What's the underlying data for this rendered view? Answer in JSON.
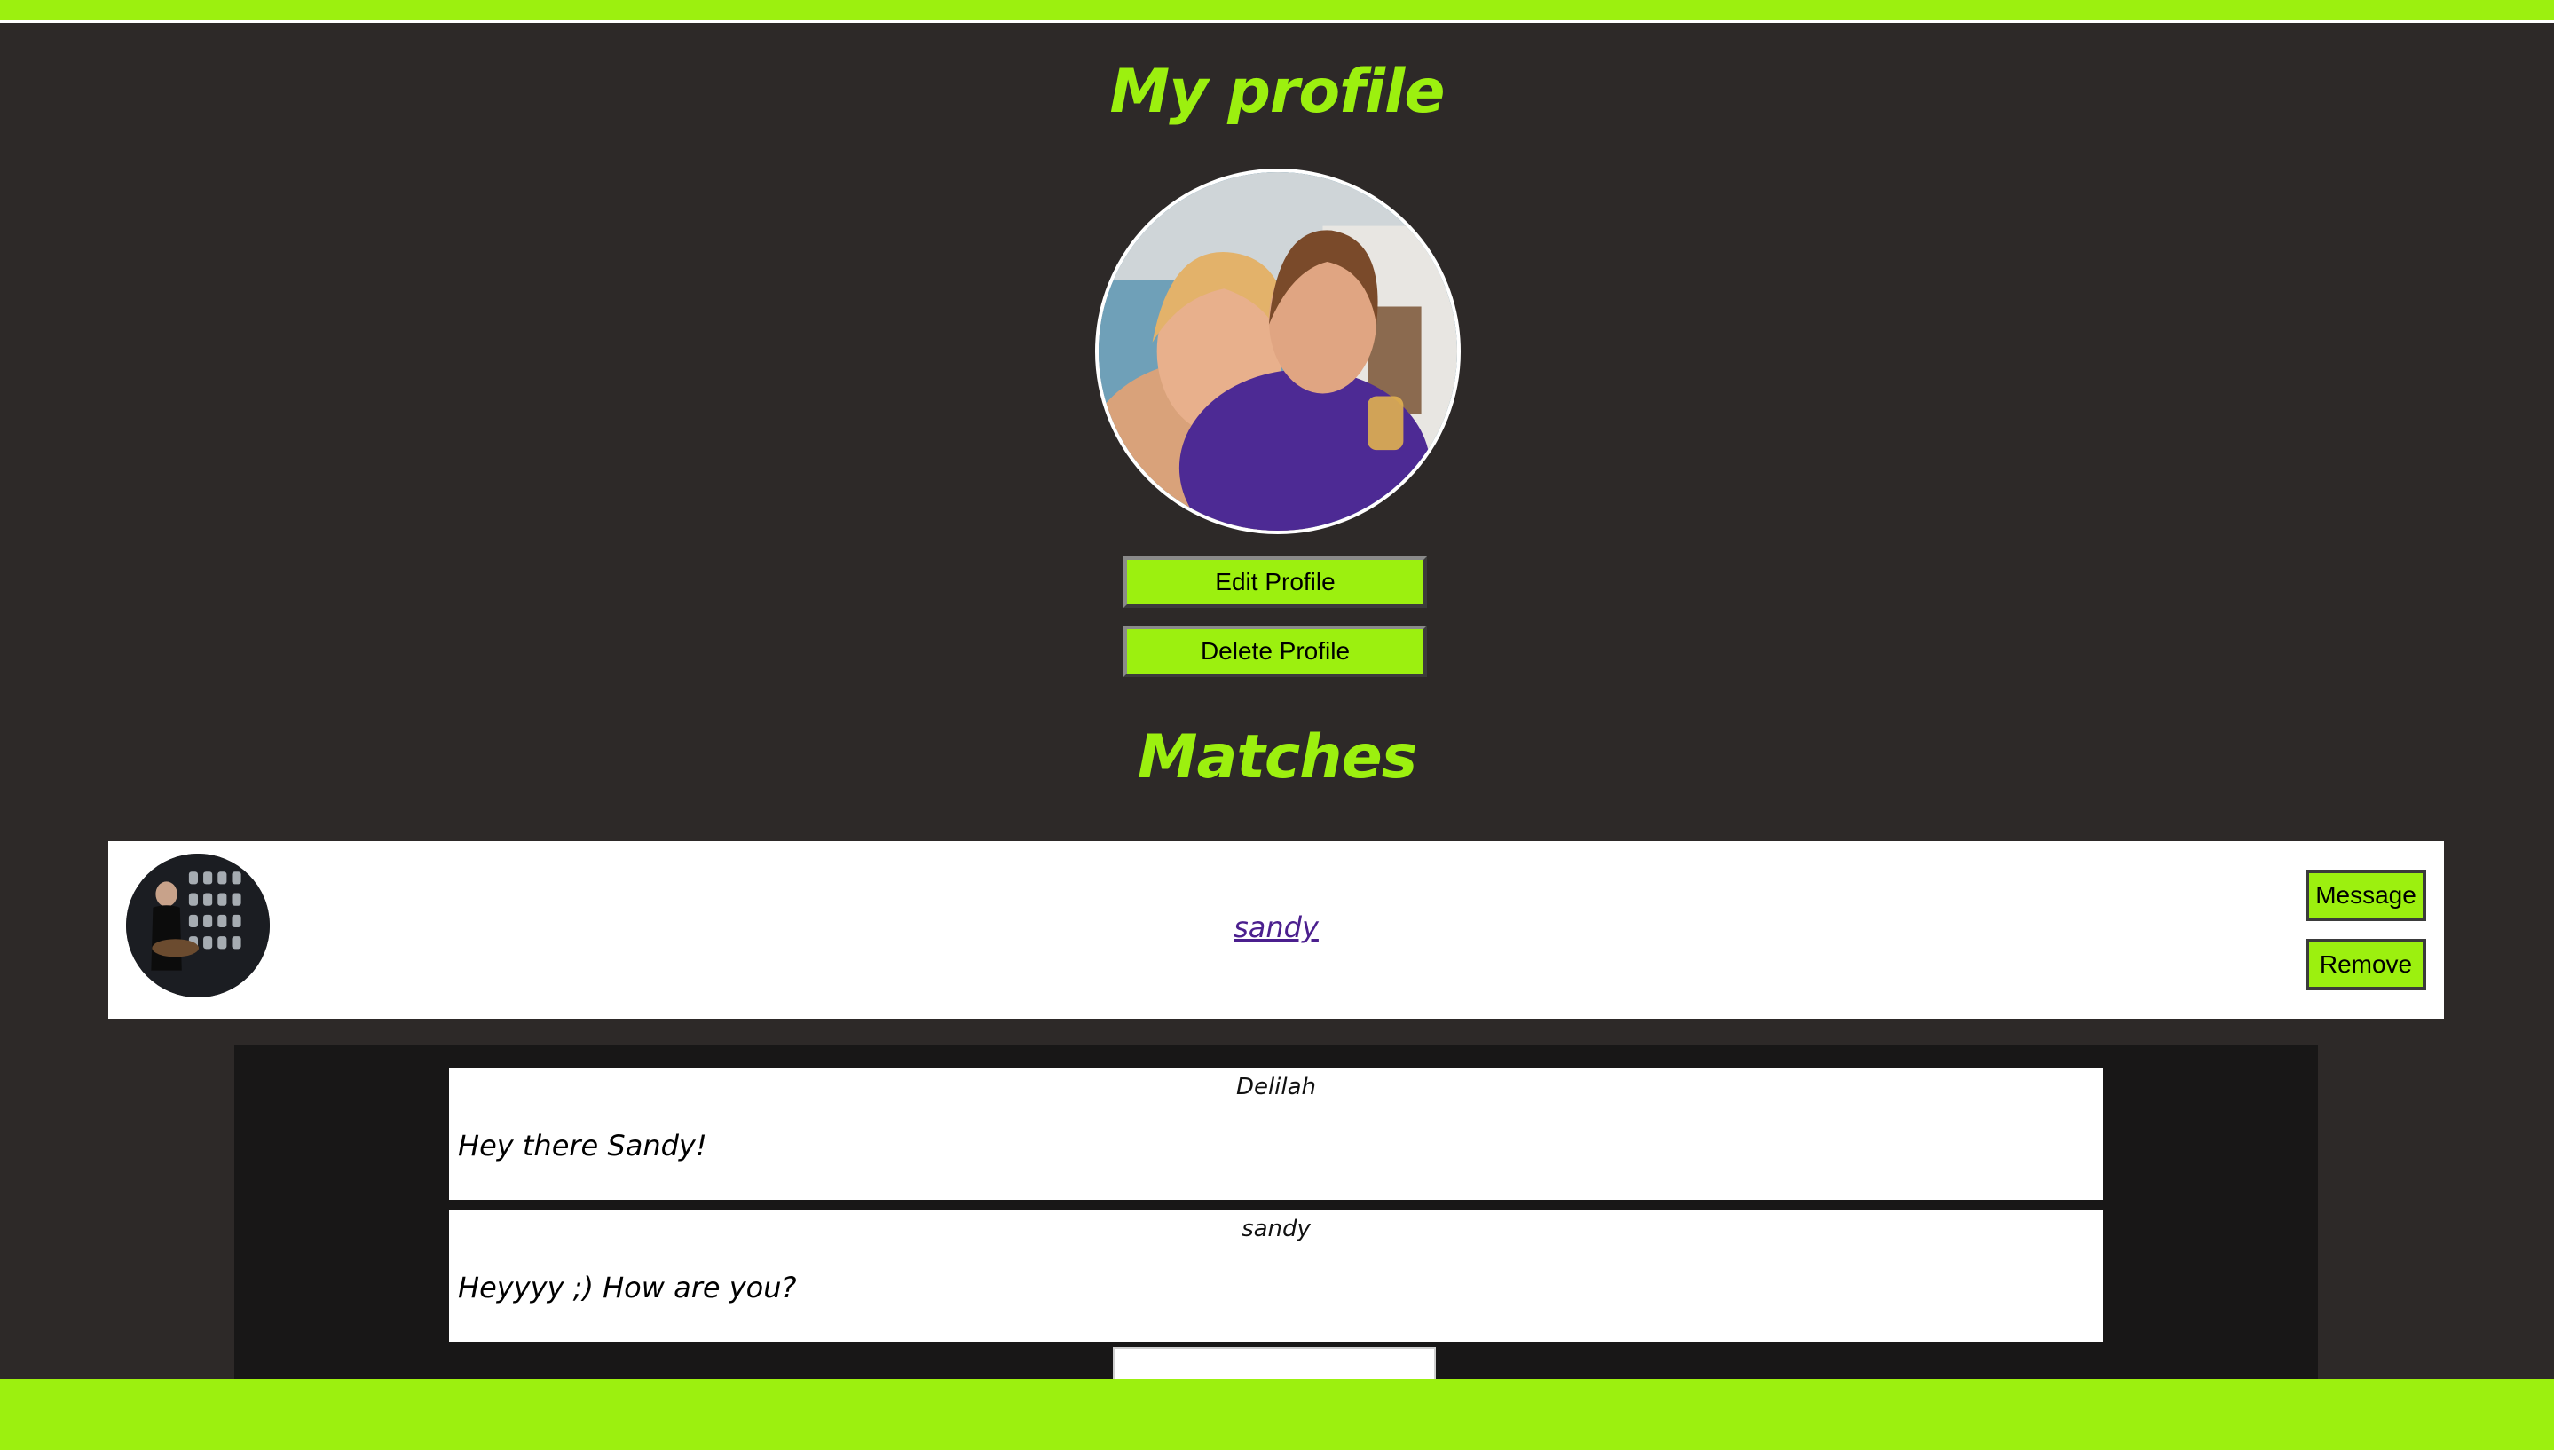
{
  "page": {
    "title": "My profile",
    "accent_color": "#9cf00f",
    "background_color": "#2d2928"
  },
  "profile": {
    "avatar_icon": "profile-photo",
    "edit_label": "Edit Profile",
    "delete_label": "Delete Profile"
  },
  "matches": {
    "title": "Matches",
    "items": [
      {
        "name": "sandy",
        "avatar_icon": "match-photo",
        "message_label": "Message",
        "remove_label": "Remove"
      }
    ]
  },
  "chat": {
    "messages": [
      {
        "author": "Delilah",
        "text": "Hey there Sandy!"
      },
      {
        "author": "sandy",
        "text": "Heyyyy ;) How are you?"
      }
    ],
    "input_value": "",
    "input_placeholder": ""
  }
}
